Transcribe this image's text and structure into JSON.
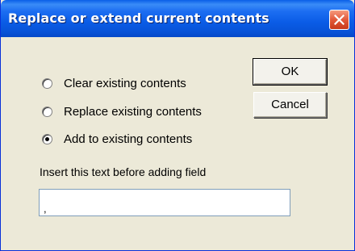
{
  "window": {
    "title": "Replace or extend current contents",
    "close_icon": "close-x-icon"
  },
  "buttons": {
    "ok": "OK",
    "cancel": "Cancel"
  },
  "options": [
    {
      "label": "Clear existing contents",
      "selected": false
    },
    {
      "label": "Replace existing contents",
      "selected": false
    },
    {
      "label": "Add to existing contents",
      "selected": true
    }
  ],
  "insert": {
    "label": "Insert this text before adding field",
    "value": ","
  },
  "colors": {
    "titlebar": "#0a5ce6",
    "dialog_bg": "#ece9d8",
    "close_button": "#e2593a"
  }
}
